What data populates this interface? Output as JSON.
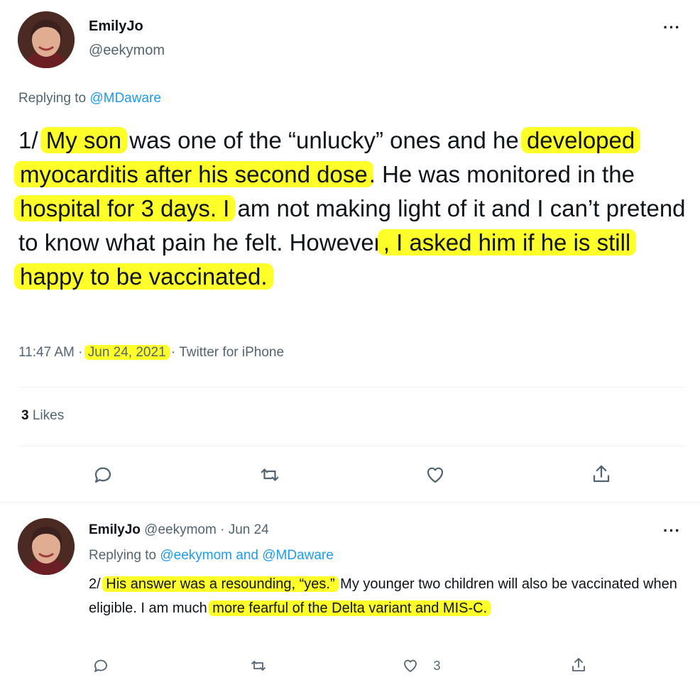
{
  "tweet1": {
    "display_name": "EmilyJo",
    "handle": "@eekymom",
    "more": "···",
    "replying_prefix": "Replying to ",
    "replying_to": "@MDaware",
    "text": {
      "p1": "1/ ",
      "h1": "My son",
      "p2": " was one of the “unlucky” ones and he ",
      "h2": "developed myocarditis after his second dose",
      "p3": ". He was monitored in the ",
      "h3": "hospital for 3 days. I",
      "p4": " am not making light of it and I can’t pretend to know what pain he felt. However",
      "h4": ", I asked him if he is still happy to be vaccinated."
    },
    "time": "11:47 AM",
    "sep1": "·",
    "date": "Jun 24, 2021",
    "sep2": "·",
    "source": "Twitter for iPhone",
    "likes_count": "3",
    "likes_label": "Likes",
    "actions": [
      "reply-icon",
      "retweet-icon",
      "like-icon",
      "share-icon"
    ]
  },
  "tweet2": {
    "display_name": "EmilyJo",
    "handle": "@eekymom",
    "sep": "·",
    "date": "Jun 24",
    "more": "···",
    "replying_prefix": "Replying to ",
    "replying_to": "@eekymom and @MDaware",
    "text": {
      "p1": "2/ ",
      "h1": "His answer was a resounding, “yes.”",
      "p2": " My younger two children will also be vaccinated when eligible. I am much ",
      "h2": "more fearful of the Delta variant and MIS-C."
    },
    "like_count": "3",
    "actions": [
      "reply-icon",
      "retweet-icon",
      "like-icon",
      "share-icon"
    ]
  },
  "colors": {
    "highlight": "#ffff2a",
    "link": "#1d9bf0",
    "secondary_text": "#536471",
    "divider": "#eff3f4"
  }
}
